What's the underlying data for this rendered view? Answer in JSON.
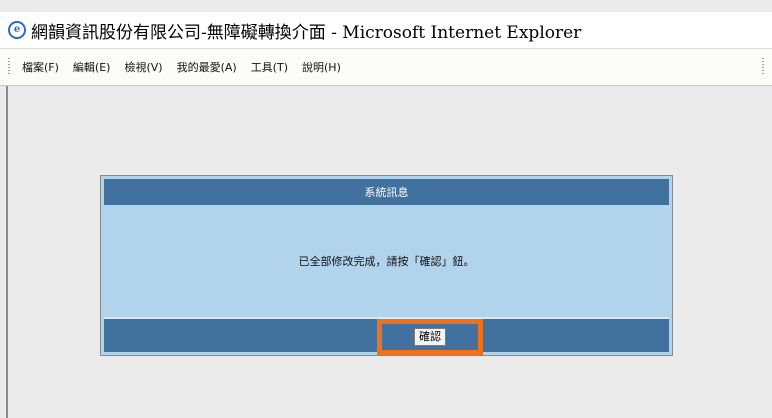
{
  "window": {
    "title": "網韻資訊股份有限公司-無障礙轉換介面 - Microsoft Internet Explorer",
    "app_icon": "ie-icon"
  },
  "menubar": {
    "items": [
      {
        "label": "檔案(F)"
      },
      {
        "label": "編輯(E)"
      },
      {
        "label": "檢視(V)"
      },
      {
        "label": "我的最愛(A)"
      },
      {
        "label": "工具(T)"
      },
      {
        "label": "說明(H)"
      }
    ]
  },
  "dialog": {
    "header": "系統訊息",
    "message": "已全部修改完成，請按「確認」鈕。",
    "confirm_label": "確認"
  },
  "colors": {
    "panel_header": "#41719f",
    "panel_body": "#b1d3ec",
    "highlight": "#f0701c"
  }
}
